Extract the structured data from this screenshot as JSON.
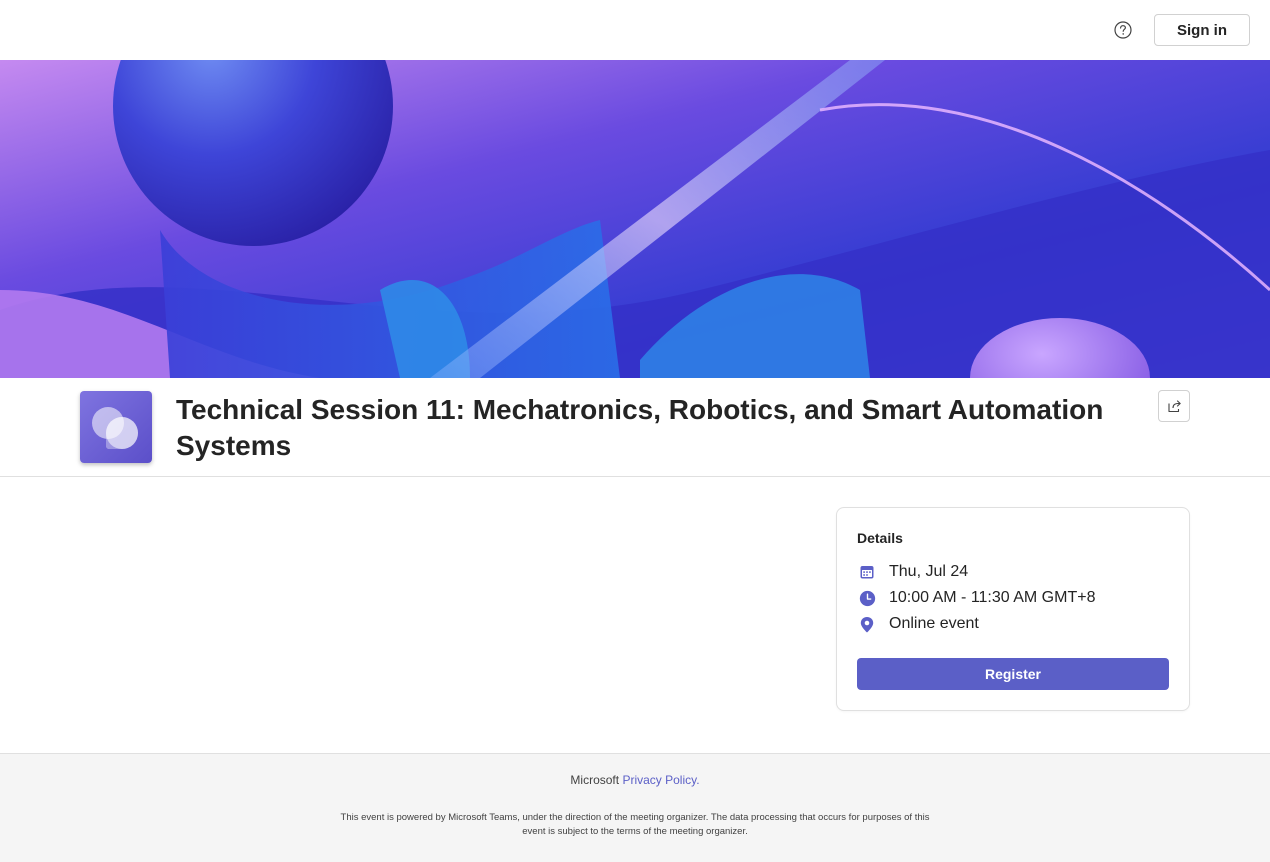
{
  "header": {
    "help_icon": "question-circle-icon",
    "sign_in_label": "Sign in"
  },
  "event": {
    "title": "Technical Session 11: Mechatronics, Robotics, and Smart Automation Systems",
    "logo_icon": "teams-events-logo",
    "share_icon": "share-icon"
  },
  "details": {
    "heading": "Details",
    "date": "Thu, Jul 24",
    "time": "10:00 AM - 11:30 AM GMT+8",
    "location": "Online event",
    "register_label": "Register",
    "icons": [
      "calendar-icon",
      "clock-icon",
      "location-pin-icon"
    ]
  },
  "footer": {
    "brand": "Microsoft",
    "privacy_link": "Privacy Policy.",
    "note": "This event is powered by Microsoft Teams, under the direction of the meeting organizer. The data processing that occurs for purposes of this event is subject to the terms of the meeting organizer."
  },
  "colors": {
    "accent": "#5b5fc7",
    "icon": "#5b5fc7",
    "banner_primary": "#3b3fd6",
    "banner_secondary": "#b06be8"
  }
}
